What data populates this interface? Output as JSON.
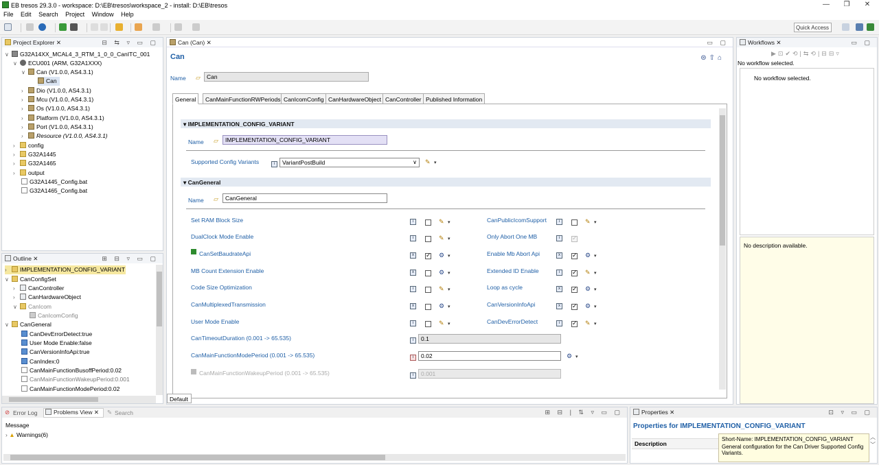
{
  "window": {
    "title": "EB tresos 29.3.0 - workspace: D:\\EB\\tresos\\workspace_2 - install: D:\\EB\\tresos"
  },
  "menu": [
    "File",
    "Edit",
    "Search",
    "Project",
    "Window",
    "Help"
  ],
  "quick_access": "Quick Access",
  "project_explorer": {
    "title": "Project Explorer",
    "items": [
      {
        "label": "G32A14XX_MCAL4_3_RTM_1_0_0_CanITC_001",
        "italic": false
      },
      {
        "label": "ECU001 (ARM, G32A1XXX)",
        "italic": false
      },
      {
        "label": "Can (V1.0.0, AS4.3.1)",
        "italic": false
      },
      {
        "label": "Can",
        "italic": false
      },
      {
        "label": "Dio (V1.0.0, AS4.3.1)",
        "italic": false
      },
      {
        "label": "Mcu (V1.0.0, AS4.3.1)",
        "italic": false
      },
      {
        "label": "Os (V1.0.0, AS4.3.1)",
        "italic": false
      },
      {
        "label": "Platform (V1.0.0, AS4.3.1)",
        "italic": false
      },
      {
        "label": "Port (V1.0.0, AS4.3.1)",
        "italic": false
      },
      {
        "label": "Resource (V1.0.0, AS4.3.1)",
        "italic": true
      },
      {
        "label": "config",
        "italic": false
      },
      {
        "label": "G32A1445",
        "italic": false
      },
      {
        "label": "G32A1465",
        "italic": false
      },
      {
        "label": "output",
        "italic": false
      },
      {
        "label": "G32A1445_Config.bat",
        "italic": false
      },
      {
        "label": "G32A1465_Config.bat",
        "italic": false
      }
    ]
  },
  "outline": {
    "title": "Outline",
    "items": [
      {
        "label": "IMPLEMENTATION_CONFIG_VARIANT"
      },
      {
        "label": "CanConfigSet"
      },
      {
        "label": "CanController"
      },
      {
        "label": "CanHardwareObject"
      },
      {
        "label": "CanIcom"
      },
      {
        "label": "CanIcomConfig"
      },
      {
        "label": "CanGeneral"
      },
      {
        "label": "CanDevErrorDetect:true"
      },
      {
        "label": "User Mode Enable:false"
      },
      {
        "label": "CanVersionInfoApi:true"
      },
      {
        "label": "CanIndex:0"
      },
      {
        "label": "CanMainFunctionBusoffPeriod:0.02"
      },
      {
        "label": "CanMainFunctionWakeupPeriod:0.001"
      },
      {
        "label": "CanMainFunctionModePeriod:0.02"
      }
    ]
  },
  "editor": {
    "tab_title": "Can (Can)",
    "heading": "Can",
    "name_label": "Name",
    "name_value": "Can",
    "tabs": [
      "General",
      "CanMainFunctionRWPeriods",
      "CanIcomConfig",
      "CanHardwareObject",
      "CanController",
      "Published Information"
    ],
    "section1": {
      "title": "IMPLEMENTATION_CONFIG_VARIANT",
      "name_label": "Name",
      "name_value": "IMPLEMENTATION_CONFIG_VARIANT",
      "variants_label": "Supported Config Variants",
      "variants_value": "VariantPostBuild"
    },
    "section2": {
      "title": "CanGeneral",
      "name_label": "Name",
      "name_value": "CanGeneral",
      "left_params": [
        {
          "label": "Set RAM Block Size",
          "checked": false
        },
        {
          "label": "DualClock Mode Enable",
          "checked": false
        },
        {
          "label": "CanSetBaudrateApi",
          "checked": true
        },
        {
          "label": "MB Count Extension Enable",
          "checked": false
        },
        {
          "label": "Code Size Optimization",
          "checked": false
        },
        {
          "label": "CanMultiplexedTransmission",
          "checked": false
        },
        {
          "label": "User Mode Enable",
          "checked": false
        }
      ],
      "right_params": [
        {
          "label": "CanPublicIcomSupport",
          "checked": false
        },
        {
          "label": "Only Abort One MB",
          "checked": true
        },
        {
          "label": "Enable Mb Abort Api",
          "checked": true
        },
        {
          "label": "Extended ID Enable",
          "checked": true
        },
        {
          "label": "Loop as cycle",
          "checked": true
        },
        {
          "label": "CanVersionInfoApi",
          "checked": true
        },
        {
          "label": "CanDevErrorDetect",
          "checked": true
        }
      ],
      "timeout_label": "CanTimeoutDuration (0.001 -> 65.535)",
      "timeout_value": "0.1",
      "mode_period_label": "CanMainFunctionModePeriod (0.001 -> 65.535)",
      "mode_period_value": "0.02",
      "wakeup_label": "CanMainFunctionWakeupPeriod (0.001 -> 65.535)",
      "wakeup_value": "0.001"
    },
    "bottom_tab": "Default"
  },
  "workflows": {
    "title": "Workflows",
    "status": "No workflow selected.",
    "list_text": "No workflow selected.",
    "description": "No description available."
  },
  "bottom": {
    "tabs": [
      "Error Log",
      "Problems View",
      "Search"
    ],
    "column": "Message",
    "row": "Warnings(6)"
  },
  "properties": {
    "title": "Properties",
    "heading": "Properties for IMPLEMENTATION_CONFIG_VARIANT",
    "column": "Description",
    "tooltip_shortname": "Short-Name: IMPLEMENTATION_CONFIG_VARIANT",
    "tooltip_text": "General configuration for the Can Driver Supported Config Variants."
  }
}
